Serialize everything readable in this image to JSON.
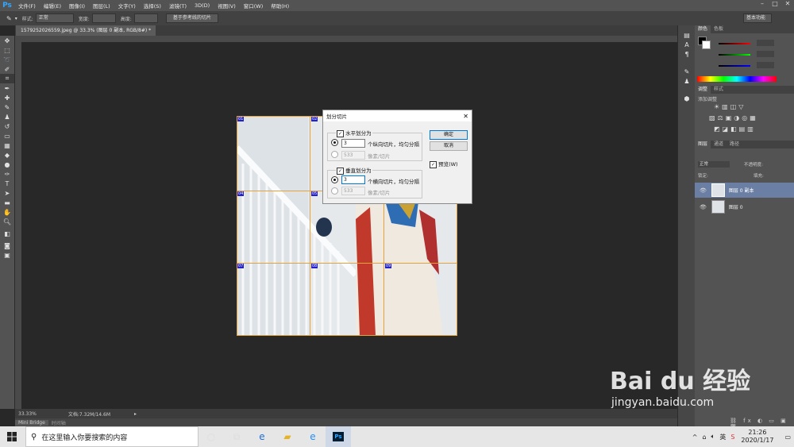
{
  "app": {
    "logo": "Ps"
  },
  "menu": [
    "文件(F)",
    "编辑(E)",
    "图像(I)",
    "图层(L)",
    "文字(Y)",
    "选择(S)",
    "滤镜(T)",
    "3D(D)",
    "视图(V)",
    "窗口(W)",
    "帮助(H)"
  ],
  "options_bar": {
    "style_label": "样式:",
    "style_value": "正常",
    "width_label": "宽度:",
    "height_label": "高度:",
    "slice_button": "基于参考线的切片",
    "workspace": "基本功能"
  },
  "document": {
    "tab_title": "1579252026559.jpeg @ 33.3% (图层 0 副本, RGB/8#) *",
    "zoom": "33.33%",
    "doc_size": "文档:7.32M/14.6M",
    "mini_bridge": "Mini Bridge",
    "timeline": "时间轴"
  },
  "slice_badges": [
    "01",
    "02",
    "03",
    "04",
    "05",
    "06",
    "07",
    "08",
    "09"
  ],
  "dialog": {
    "title": "划分切片",
    "horizontal_label": "水平划分为",
    "horizontal_count": "3",
    "horizontal_count_suffix": "个纵向切片，均匀分隔",
    "horizontal_px": "533",
    "horizontal_px_suffix": "像素/切片",
    "vertical_label": "垂直划分为",
    "vertical_count": "3",
    "vertical_count_suffix": "个横向切片，均匀分隔",
    "vertical_px": "533",
    "vertical_px_suffix": "像素/切片",
    "ok": "确定",
    "cancel": "取消",
    "preview": "预览(W)"
  },
  "panels": {
    "color_tabs": [
      "颜色",
      "色板"
    ],
    "adjust_tabs": [
      "调整",
      "样式"
    ],
    "adjust_label": "添加调整",
    "layer_tabs": [
      "图层",
      "通道",
      "路径"
    ],
    "blend_mode": "正常",
    "opacity_label": "不透明度:",
    "lock_label": "锁定:",
    "fill_label": "填充:",
    "layers": [
      "图层 0 副本",
      "图层 0"
    ]
  },
  "taskbar": {
    "search_placeholder": "在这里输入你要搜索的内容",
    "time": "21:26",
    "date": "2020/1/17",
    "ime": "英"
  },
  "watermark": {
    "brand": "Bai du 经验",
    "url": "jingyan.baidu.com"
  }
}
